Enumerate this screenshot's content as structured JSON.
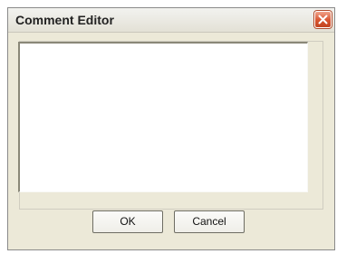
{
  "window": {
    "title": "Comment Editor",
    "close_icon": "close-icon",
    "accent_close": "#d8542f"
  },
  "editor": {
    "value": ""
  },
  "buttons": {
    "ok_label": "OK",
    "cancel_label": "Cancel"
  }
}
